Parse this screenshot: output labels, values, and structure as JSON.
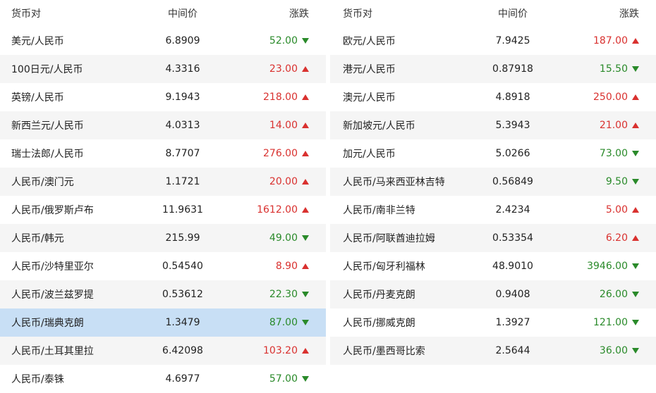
{
  "headers": {
    "pair": "货币对",
    "mid": "中间价",
    "change": "涨跌"
  },
  "colors": {
    "up": "#d9312f",
    "down": "#2a8a2a",
    "selected": "#c8dff5"
  },
  "left": [
    {
      "pair": "美元/人民币",
      "mid": "6.8909",
      "change": "52.00",
      "dir": "down"
    },
    {
      "pair": "100日元/人民币",
      "mid": "4.3316",
      "change": "23.00",
      "dir": "up"
    },
    {
      "pair": "英镑/人民币",
      "mid": "9.1943",
      "change": "218.00",
      "dir": "up"
    },
    {
      "pair": "新西兰元/人民币",
      "mid": "4.0313",
      "change": "14.00",
      "dir": "up"
    },
    {
      "pair": "瑞士法郎/人民币",
      "mid": "8.7707",
      "change": "276.00",
      "dir": "up"
    },
    {
      "pair": "人民币/澳门元",
      "mid": "1.1721",
      "change": "20.00",
      "dir": "up"
    },
    {
      "pair": "人民币/俄罗斯卢布",
      "mid": "11.9631",
      "change": "1612.00",
      "dir": "up"
    },
    {
      "pair": "人民币/韩元",
      "mid": "215.99",
      "change": "49.00",
      "dir": "down"
    },
    {
      "pair": "人民币/沙特里亚尔",
      "mid": "0.54540",
      "change": "8.90",
      "dir": "up"
    },
    {
      "pair": "人民币/波兰兹罗提",
      "mid": "0.53612",
      "change": "22.30",
      "dir": "down"
    },
    {
      "pair": "人民币/瑞典克朗",
      "mid": "1.3479",
      "change": "87.00",
      "dir": "down",
      "selected": true
    },
    {
      "pair": "人民币/土耳其里拉",
      "mid": "6.42098",
      "change": "103.20",
      "dir": "up"
    },
    {
      "pair": "人民币/泰铢",
      "mid": "4.6977",
      "change": "57.00",
      "dir": "down"
    }
  ],
  "right": [
    {
      "pair": "欧元/人民币",
      "mid": "7.9425",
      "change": "187.00",
      "dir": "up"
    },
    {
      "pair": "港元/人民币",
      "mid": "0.87918",
      "change": "15.50",
      "dir": "down"
    },
    {
      "pair": "澳元/人民币",
      "mid": "4.8918",
      "change": "250.00",
      "dir": "up"
    },
    {
      "pair": "新加坡元/人民币",
      "mid": "5.3943",
      "change": "21.00",
      "dir": "up"
    },
    {
      "pair": "加元/人民币",
      "mid": "5.0266",
      "change": "73.00",
      "dir": "down"
    },
    {
      "pair": "人民币/马来西亚林吉特",
      "mid": "0.56849",
      "change": "9.50",
      "dir": "down"
    },
    {
      "pair": "人民币/南非兰特",
      "mid": "2.4234",
      "change": "5.00",
      "dir": "up"
    },
    {
      "pair": "人民币/阿联酋迪拉姆",
      "mid": "0.53354",
      "change": "6.20",
      "dir": "up"
    },
    {
      "pair": "人民币/匈牙利福林",
      "mid": "48.9010",
      "change": "3946.00",
      "dir": "down"
    },
    {
      "pair": "人民币/丹麦克朗",
      "mid": "0.9408",
      "change": "26.00",
      "dir": "down"
    },
    {
      "pair": "人民币/挪威克朗",
      "mid": "1.3927",
      "change": "121.00",
      "dir": "down"
    },
    {
      "pair": "人民币/墨西哥比索",
      "mid": "2.5644",
      "change": "36.00",
      "dir": "down"
    }
  ]
}
